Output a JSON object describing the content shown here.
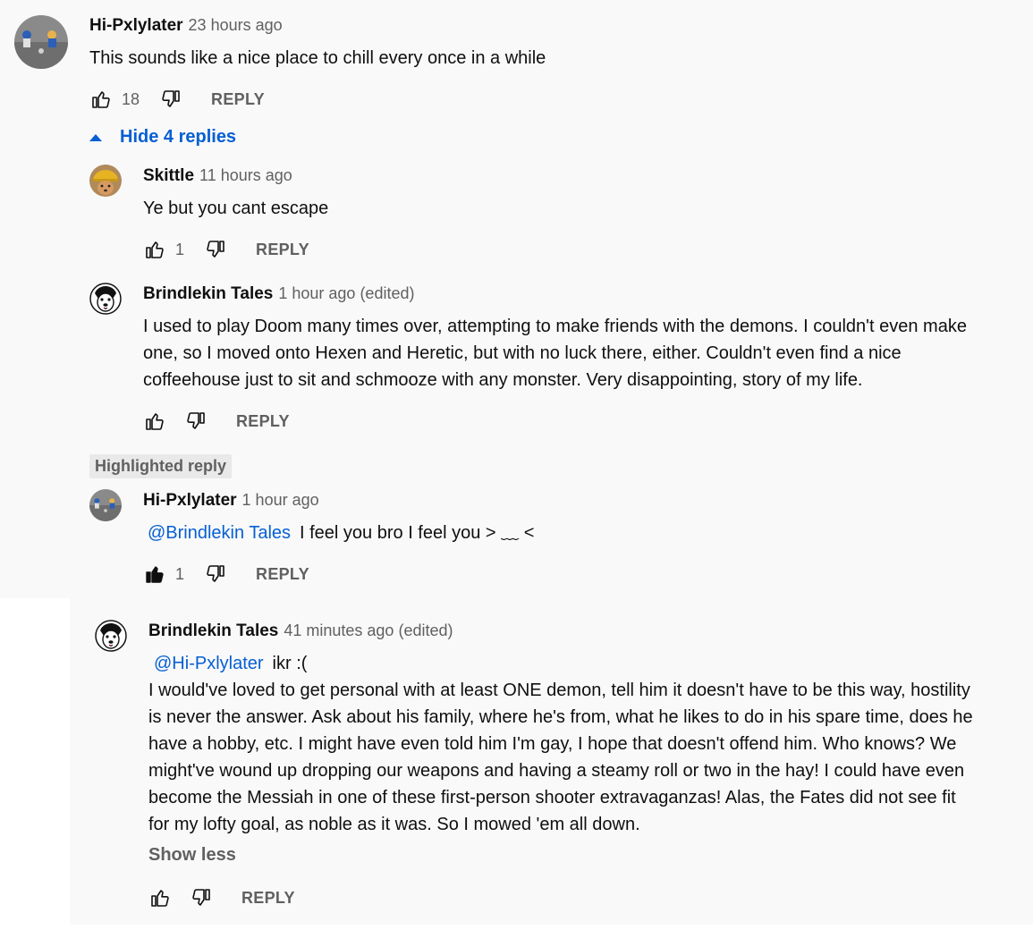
{
  "comments": [
    {
      "author": "Hi-Pxlylater",
      "time": "23 hours ago",
      "text": "This sounds like a nice place to chill every once in a while",
      "likes": "18",
      "reply_label": "REPLY",
      "avatar": "hi-pxlylater-avatar"
    }
  ],
  "replies_toggle": {
    "label": "Hide 4 replies",
    "icon": "caret-up-icon"
  },
  "replies": [
    {
      "author": "Skittle",
      "time": "11 hours ago",
      "text": "Ye but you cant escape",
      "likes": "1",
      "reply_label": "REPLY",
      "avatar": "skittle-avatar"
    },
    {
      "author": "Brindlekin Tales",
      "time": "1 hour ago",
      "edited": "(edited)",
      "text_lines": [
        "I used to play Doom many times over, attempting to make friends with the demons. I couldn't even make",
        "one, so I moved onto Hexen and Heretic, but with no luck there, either. Couldn't even find a nice",
        "coffeehouse just to sit and schmooze with any monster. Very disappointing, story of my life."
      ],
      "reply_label": "REPLY",
      "avatar": "dog-avatar"
    },
    {
      "badge": "Highlighted reply",
      "author": "Hi-Pxlylater",
      "time": "1 hour ago",
      "mention": "@Brindlekin Tales",
      "text": "I feel you bro I feel you  > ﹏ <",
      "likes": "1",
      "liked": true,
      "reply_label": "REPLY",
      "avatar": "hi-pxlylater-avatar"
    },
    {
      "author": "Brindlekin Tales",
      "time": "41 minutes ago",
      "edited": "(edited)",
      "mention": "@Hi-Pxlylater",
      "first_line_text": "ikr :(",
      "text_lines": [
        "I would've loved to get personal with at least ONE demon, tell him it doesn't have to be this way, hostility",
        "is never the answer. Ask about his family, where he's from, what he likes to do in his spare time, does he",
        "have a hobby, etc. I might have even told him I'm gay, I hope that doesn't offend him. Who knows? We",
        "might've wound up dropping our weapons  and having a steamy roll or two in the hay! I could have even",
        "become the Messiah in one of these first-person shooter extravaganzas! Alas, the Fates did not see fit",
        "for my lofty goal, as noble as it was. So I mowed 'em all down."
      ],
      "show_less": "Show less",
      "reply_label": "REPLY",
      "avatar": "dog-avatar"
    }
  ],
  "colors": {
    "link": "#065fd4",
    "secondary": "#606060",
    "background": "#f9f9f9",
    "chip": "#e9e9e9"
  }
}
